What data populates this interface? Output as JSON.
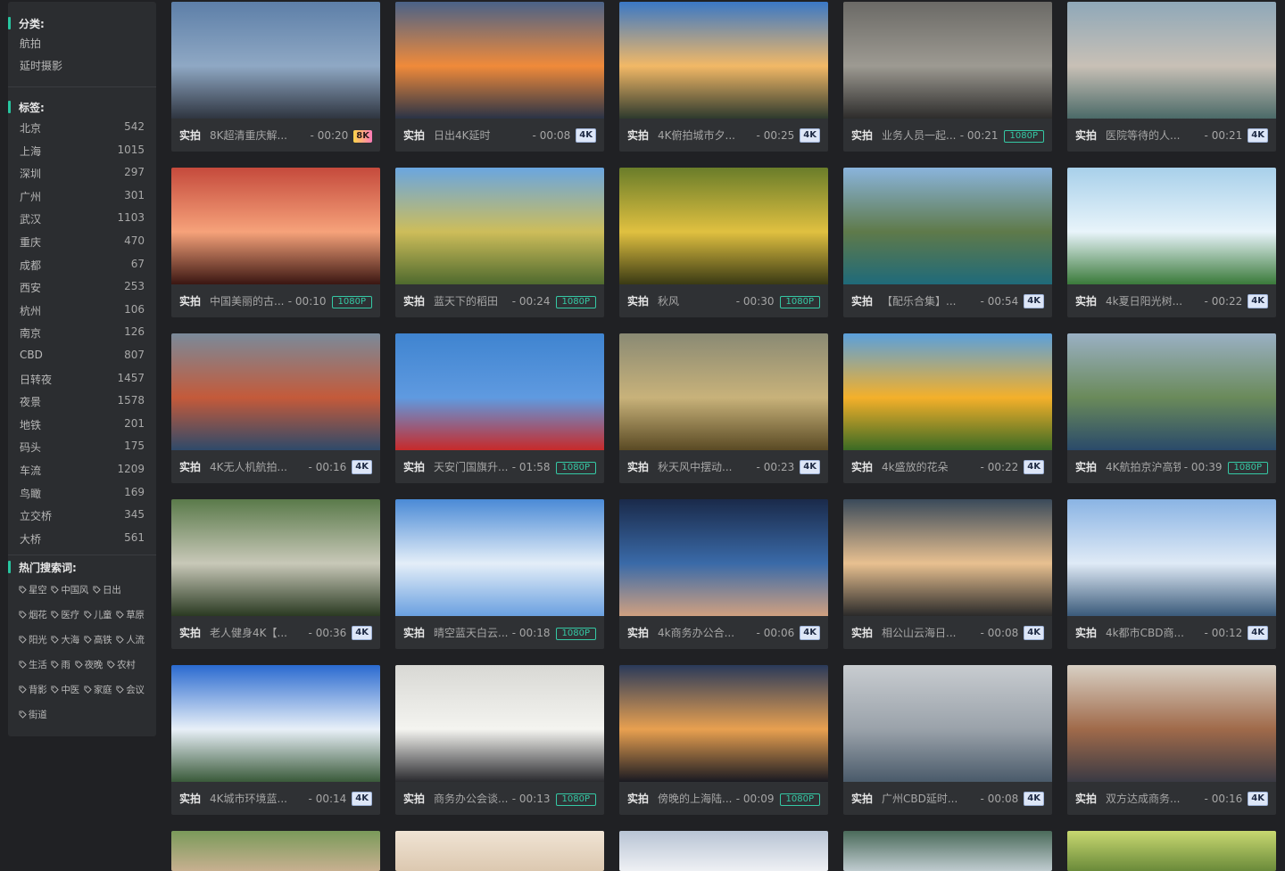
{
  "sidebar": {
    "category_heading": "分类:",
    "categories": [
      "航拍",
      "延时摄影"
    ],
    "tag_heading": "标签:",
    "tags": [
      {
        "name": "北京",
        "count": "542"
      },
      {
        "name": "上海",
        "count": "1015"
      },
      {
        "name": "深圳",
        "count": "297"
      },
      {
        "name": "广州",
        "count": "301"
      },
      {
        "name": "武汉",
        "count": "1103"
      },
      {
        "name": "重庆",
        "count": "470"
      },
      {
        "name": "成都",
        "count": "67"
      },
      {
        "name": "西安",
        "count": "253"
      },
      {
        "name": "杭州",
        "count": "106"
      },
      {
        "name": "南京",
        "count": "126"
      },
      {
        "name": "CBD",
        "count": "807"
      },
      {
        "name": "日转夜",
        "count": "1457"
      },
      {
        "name": "夜景",
        "count": "1578"
      },
      {
        "name": "地铁",
        "count": "201"
      },
      {
        "name": "码头",
        "count": "175"
      },
      {
        "name": "车流",
        "count": "1209"
      },
      {
        "name": "鸟瞰",
        "count": "169"
      },
      {
        "name": "立交桥",
        "count": "345"
      },
      {
        "name": "大桥",
        "count": "561"
      }
    ],
    "hot_heading": "热门搜索词:",
    "hot_lines": [
      [
        "星空",
        "中国风",
        "日出"
      ],
      [
        "烟花",
        "医疗",
        "儿童",
        "草原"
      ],
      [
        "阳光",
        "大海",
        "高铁",
        "人流"
      ],
      [
        "生活",
        "雨",
        "夜晚",
        "农村"
      ],
      [
        "背影",
        "中医",
        "家庭",
        "会议"
      ],
      [
        "街道"
      ]
    ]
  },
  "videos": [
    {
      "kind": "实拍",
      "title": "8K超清重庆解...",
      "duration": "- 00:20",
      "res": "8K",
      "colors": [
        "#5d7fa8",
        "#8fa8c4",
        "#2f3540"
      ]
    },
    {
      "kind": "实拍",
      "title": "日出4K延时",
      "duration": "- 00:08",
      "res": "4K",
      "colors": [
        "#4a6288",
        "#f08a3a",
        "#2a3346"
      ]
    },
    {
      "kind": "实拍",
      "title": "4K俯拍城市夕...",
      "duration": "- 00:25",
      "res": "4K",
      "colors": [
        "#3a78c6",
        "#f2b866",
        "#2e3a2e"
      ]
    },
    {
      "kind": "实拍",
      "title": "业务人员一起...",
      "duration": "- 00:21",
      "res": "1080P",
      "colors": [
        "#6b6a66",
        "#9d9a92",
        "#2d2c2b"
      ]
    },
    {
      "kind": "实拍",
      "title": "医院等待的人...",
      "duration": "- 00:21",
      "res": "4K",
      "colors": [
        "#8fa8b8",
        "#c8c0b6",
        "#4b6a68"
      ]
    },
    {
      "kind": "实拍",
      "title": "中国美丽的古...",
      "duration": "- 00:10",
      "res": "1080P",
      "colors": [
        "#c54a3c",
        "#f6a27a",
        "#3a1612"
      ]
    },
    {
      "kind": "实拍",
      "title": "蓝天下的稻田",
      "duration": "- 00:24",
      "res": "1080P",
      "colors": [
        "#6aa6e0",
        "#cdbd5a",
        "#4f6a2e"
      ]
    },
    {
      "kind": "实拍",
      "title": "秋风",
      "duration": "- 00:30",
      "res": "1080P",
      "colors": [
        "#6a7d2a",
        "#e0c040",
        "#3a3a14"
      ]
    },
    {
      "kind": "实拍",
      "title": "【配乐合集】...",
      "duration": "- 00:54",
      "res": "4K",
      "colors": [
        "#8ab4dc",
        "#5f7a4a",
        "#1f6a7a"
      ]
    },
    {
      "kind": "实拍",
      "title": "4k夏日阳光树...",
      "duration": "- 00:22",
      "res": "4K",
      "colors": [
        "#a8d0ea",
        "#e8f4fa",
        "#3a7a3a"
      ]
    },
    {
      "kind": "实拍",
      "title": "4K无人机航拍...",
      "duration": "- 00:16",
      "res": "4K",
      "colors": [
        "#7a8a9a",
        "#c45a3a",
        "#2e4a6a"
      ]
    },
    {
      "kind": "实拍",
      "title": "天安门国旗升...",
      "duration": "- 01:58",
      "res": "1080P",
      "colors": [
        "#3f84d0",
        "#5f9ae0",
        "#c72a2a"
      ]
    },
    {
      "kind": "实拍",
      "title": "秋天风中摆动...",
      "duration": "- 00:23",
      "res": "4K",
      "colors": [
        "#8a8a74",
        "#c8b27a",
        "#5a4a24"
      ]
    },
    {
      "kind": "实拍",
      "title": "4k盛放的花朵",
      "duration": "- 00:22",
      "res": "4K",
      "colors": [
        "#5aa0dc",
        "#f4b02a",
        "#3a6a24"
      ]
    },
    {
      "kind": "实拍",
      "title": "4K航拍京沪高铁",
      "duration": "- 00:39",
      "res": "1080P",
      "colors": [
        "#9ab0c4",
        "#6a8a5a",
        "#2a4a6a"
      ]
    },
    {
      "kind": "实拍",
      "title": "老人健身4K【...",
      "duration": "- 00:36",
      "res": "4K",
      "colors": [
        "#5a7a4a",
        "#c8c8b8",
        "#2a3a22"
      ]
    },
    {
      "kind": "实拍",
      "title": "晴空蓝天白云...",
      "duration": "- 00:18",
      "res": "1080P",
      "colors": [
        "#4a8ad6",
        "#e4eef8",
        "#6aa0e0"
      ]
    },
    {
      "kind": "实拍",
      "title": "4k商务办公合...",
      "duration": "- 00:06",
      "res": "4K",
      "colors": [
        "#1a2a4a",
        "#3a6aa8",
        "#d0a080"
      ]
    },
    {
      "kind": "实拍",
      "title": "相公山云海日...",
      "duration": "- 00:08",
      "res": "4K",
      "colors": [
        "#3a4a5a",
        "#e8c090",
        "#2a2a2a"
      ]
    },
    {
      "kind": "实拍",
      "title": "4k都市CBD商...",
      "duration": "- 00:12",
      "res": "4K",
      "colors": [
        "#8ab4e4",
        "#dfeaf6",
        "#3a5a7a"
      ]
    },
    {
      "kind": "实拍",
      "title": "4K城市环境蓝...",
      "duration": "- 00:14",
      "res": "4K",
      "colors": [
        "#2a6ad0",
        "#e8f0f8",
        "#3a5a3a"
      ]
    },
    {
      "kind": "实拍",
      "title": "商务办公会谈...",
      "duration": "- 00:13",
      "res": "1080P",
      "colors": [
        "#d8d8d4",
        "#f4f4f0",
        "#2a2a2e"
      ]
    },
    {
      "kind": "实拍",
      "title": "傍晚的上海陆...",
      "duration": "- 00:09",
      "res": "1080P",
      "colors": [
        "#2a3a5a",
        "#e8a050",
        "#1a1a22"
      ]
    },
    {
      "kind": "实拍",
      "title": "广州CBD延时...",
      "duration": "- 00:08",
      "res": "4K",
      "colors": [
        "#c8ccd0",
        "#9aa2aa",
        "#4a5a6a"
      ]
    },
    {
      "kind": "实拍",
      "title": "双方达成商务...",
      "duration": "- 00:16",
      "res": "4K",
      "colors": [
        "#d8d0c4",
        "#a06a4a",
        "#3a3a44"
      ]
    }
  ],
  "partial_row_colors": [
    [
      "#7a9a5a",
      "#c8b090"
    ],
    [
      "#f0e4d4",
      "#dcc8b0"
    ],
    [
      "#b8c4d4",
      "#eef0f4"
    ],
    [
      "#4a6a5a",
      "#c0ccd0"
    ],
    [
      "#c8d870",
      "#6a8a3a"
    ]
  ]
}
